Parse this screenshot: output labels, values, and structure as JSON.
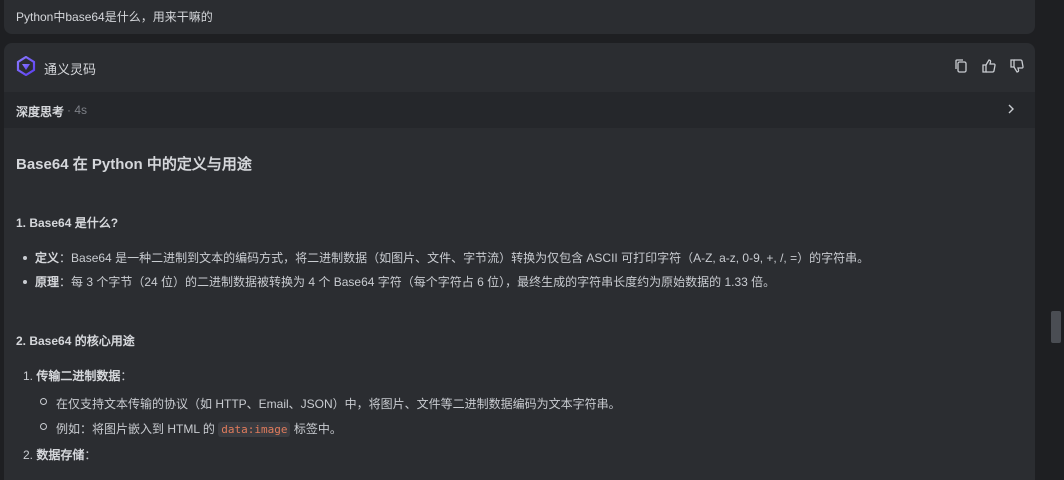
{
  "user_message": "Python中base64是什么，用来干嘛的",
  "assistant": {
    "name": "通义灵码",
    "icons": [
      "copy-icon",
      "thumbs-up-icon",
      "thumbs-down-icon"
    ]
  },
  "thinking": {
    "label": "深度思考",
    "duration": "· 4s"
  },
  "answer": {
    "title": "Base64 在 Python 中的定义与用途",
    "section1": {
      "heading": "1. Base64 是什么?",
      "items": [
        {
          "term": "定义",
          "sep": "：",
          "text": "Base64 是一种二进制到文本的编码方式，将二进制数据（如图片、文件、字节流）转换为仅包含 ASCII 可打印字符（A-Z, a-z, 0-9, +, /, =）的字符串。"
        },
        {
          "term": "原理",
          "sep": "：",
          "text": "每 3 个字节（24 位）的二进制数据被转换为 4 个 Base64 字符（每个字符占 6 位），最终生成的字符串长度约为原始数据的 1.33 倍。"
        }
      ]
    },
    "section2": {
      "heading": "2. Base64 的核心用途",
      "item1": {
        "num": "1.",
        "title": "传输二进制数据",
        "colon": "：",
        "sub1": "在仅支持文本传输的协议（如 HTTP、Email、JSON）中，将图片、文件等二进制数据编码为文本字符串。",
        "sub2_before": "例如：将图片嵌入到 HTML 的",
        "sub2_code": "data:image",
        "sub2_after": "标签中。"
      },
      "item2": {
        "num": "2.",
        "title": "数据存储",
        "colon": "："
      }
    }
  },
  "colors": {
    "background": "#1e1f22",
    "panel": "#2b2d31",
    "code_text": "#e07b5c",
    "accent": "#7b61ff"
  }
}
